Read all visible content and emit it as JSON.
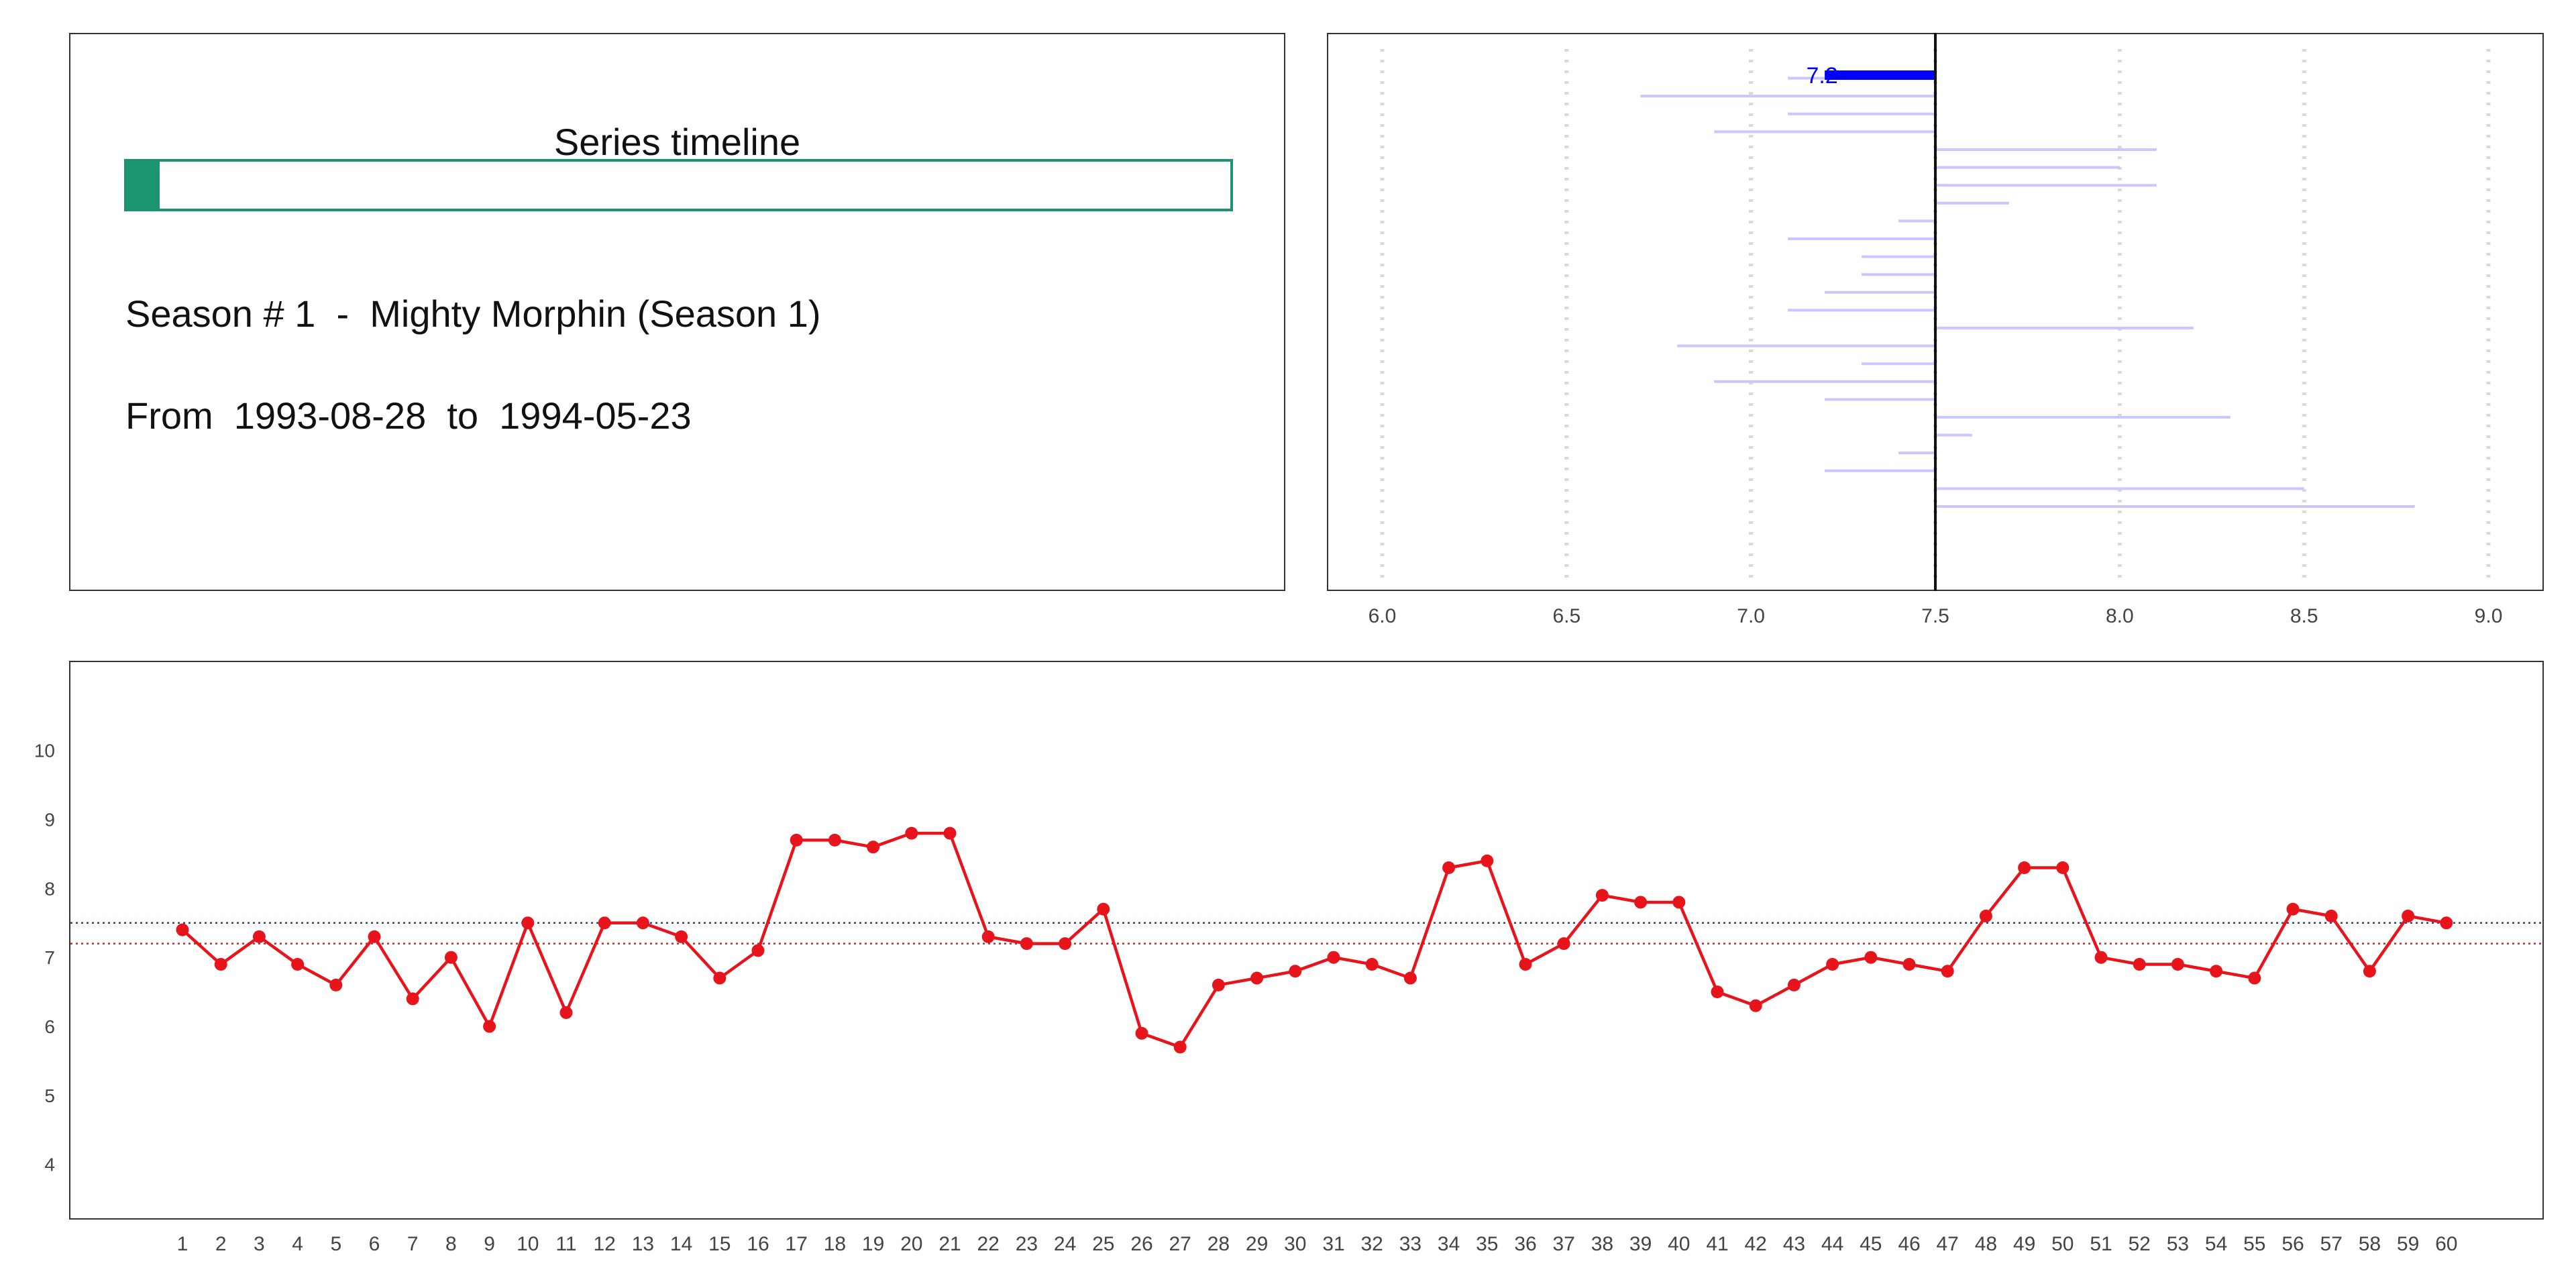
{
  "info": {
    "title": "Series timeline",
    "progress": 0.03,
    "season_prefix": "Season # ",
    "season_number": "1",
    "season_sep": "  -  ",
    "season_name": "Mighty Morphin (Season 1)",
    "from_label": "From  ",
    "start_date": "1993-08-28",
    "to_label": "  to  ",
    "end_date": "1994-05-23"
  },
  "chart_data": [
    {
      "type": "bar",
      "orientation": "horizontal",
      "baseline": 7.5,
      "xlim": [
        5.85,
        9.15
      ],
      "xticks": [
        "6.0",
        "6.5",
        "7.0",
        "7.5",
        "8.0",
        "8.5",
        "9.0"
      ],
      "grid": "vertical dotted",
      "highlight": {
        "value": 7.2,
        "label": "7.2",
        "color": "#0000ff"
      },
      "values": [
        7.1,
        6.7,
        7.1,
        6.9,
        8.1,
        8.0,
        8.1,
        7.7,
        7.4,
        7.1,
        7.3,
        7.3,
        7.2,
        7.1,
        8.2,
        6.8,
        7.3,
        6.9,
        7.2,
        8.3,
        7.6,
        7.4,
        7.2,
        8.5,
        8.8
      ],
      "color": "#c8c8ff"
    },
    {
      "type": "line",
      "x": [
        1,
        2,
        3,
        4,
        5,
        6,
        7,
        8,
        9,
        10,
        11,
        12,
        13,
        14,
        15,
        16,
        17,
        18,
        19,
        20,
        21,
        22,
        23,
        24,
        25,
        26,
        27,
        28,
        29,
        30,
        31,
        32,
        33,
        34,
        35,
        36,
        37,
        38,
        39,
        40,
        41,
        42,
        43,
        44,
        45,
        46,
        47,
        48,
        49,
        50,
        51,
        52,
        53,
        54,
        55,
        56,
        57,
        58,
        59,
        60
      ],
      "y": [
        7.4,
        6.9,
        7.3,
        6.9,
        6.6,
        7.3,
        6.4,
        7.0,
        6.0,
        7.5,
        6.2,
        7.5,
        7.5,
        7.3,
        6.7,
        7.1,
        8.7,
        8.7,
        8.6,
        8.8,
        8.8,
        7.3,
        7.2,
        7.2,
        7.7,
        5.9,
        5.7,
        6.6,
        6.7,
        6.8,
        7.0,
        6.9,
        6.7,
        8.3,
        8.4,
        6.9,
        7.2,
        7.9,
        7.8,
        7.8,
        6.5,
        6.3,
        6.6,
        6.9,
        7.0,
        6.9,
        6.8,
        7.6,
        8.3,
        8.3,
        7.0,
        6.9,
        6.9,
        6.8,
        6.7,
        7.7,
        7.6,
        6.8,
        7.6,
        7.5
      ],
      "yticks": [
        "4",
        "5",
        "6",
        "7",
        "8",
        "9",
        "10"
      ],
      "ylim": [
        3.2,
        11.3
      ],
      "reference_lines": [
        {
          "value": 7.5,
          "color": "#2b3fa0",
          "style": "dotted"
        },
        {
          "value": 7.2,
          "color": "#e31a1c",
          "style": "dotted"
        }
      ],
      "series_color": "#e8141c"
    }
  ]
}
